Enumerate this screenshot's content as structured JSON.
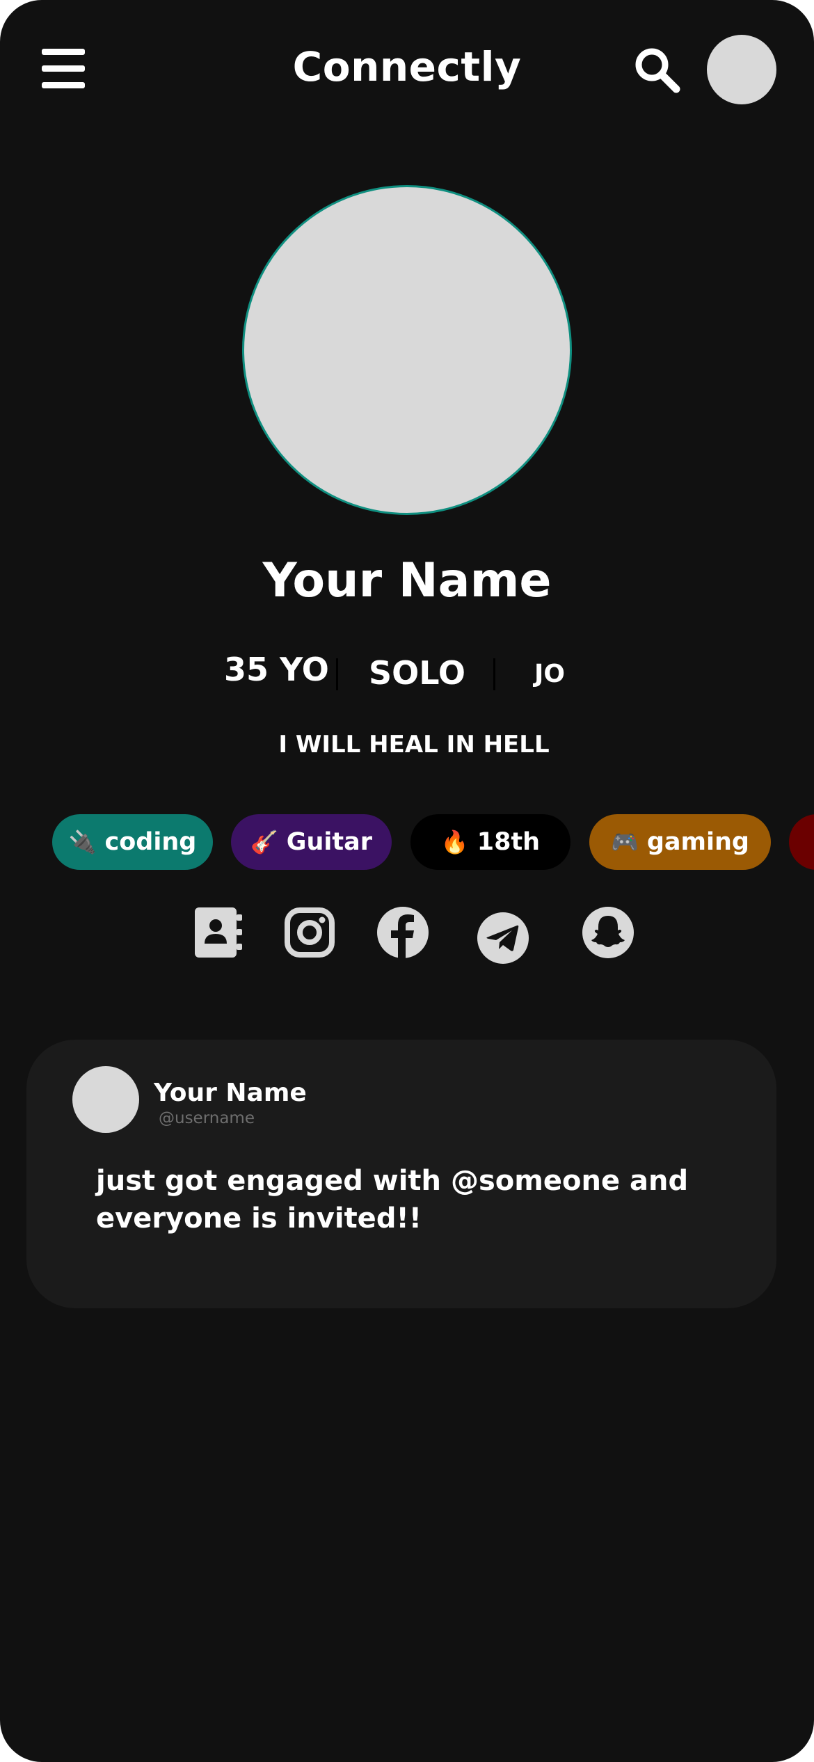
{
  "header": {
    "app_title": "Connectly",
    "menu_icon": "hamburger-menu-icon",
    "search_icon": "search-icon"
  },
  "profile": {
    "name": "Your Name",
    "age": "35 YO",
    "status": "SOLO",
    "country": "JO",
    "bio": "I WILL HEAL IN HELL"
  },
  "tags": [
    {
      "emoji": "🔌",
      "label": "coding",
      "color": "#0c7a6e"
    },
    {
      "emoji": "🎸",
      "label": "Guitar",
      "color": "#3b1263"
    },
    {
      "emoji": "🔥",
      "label": "18th",
      "color": "#000000"
    },
    {
      "emoji": "🎮",
      "label": "gaming",
      "color": "#9b5a04"
    },
    {
      "emoji": "",
      "label": "",
      "color": "#6b0000"
    }
  ],
  "social_links": [
    "contacts-icon",
    "instagram-icon",
    "facebook-icon",
    "telegram-icon",
    "snapchat-icon"
  ],
  "post": {
    "author_name": "Your Name",
    "username": "@username",
    "text": "just got engaged with @someone and everyone is invited!!"
  },
  "colors": {
    "background": "#111111",
    "card": "#1b1b1b",
    "avatar_placeholder": "#d9d9d9",
    "avatar_ring": "#0f8f80",
    "icon": "#d9d9d9"
  }
}
